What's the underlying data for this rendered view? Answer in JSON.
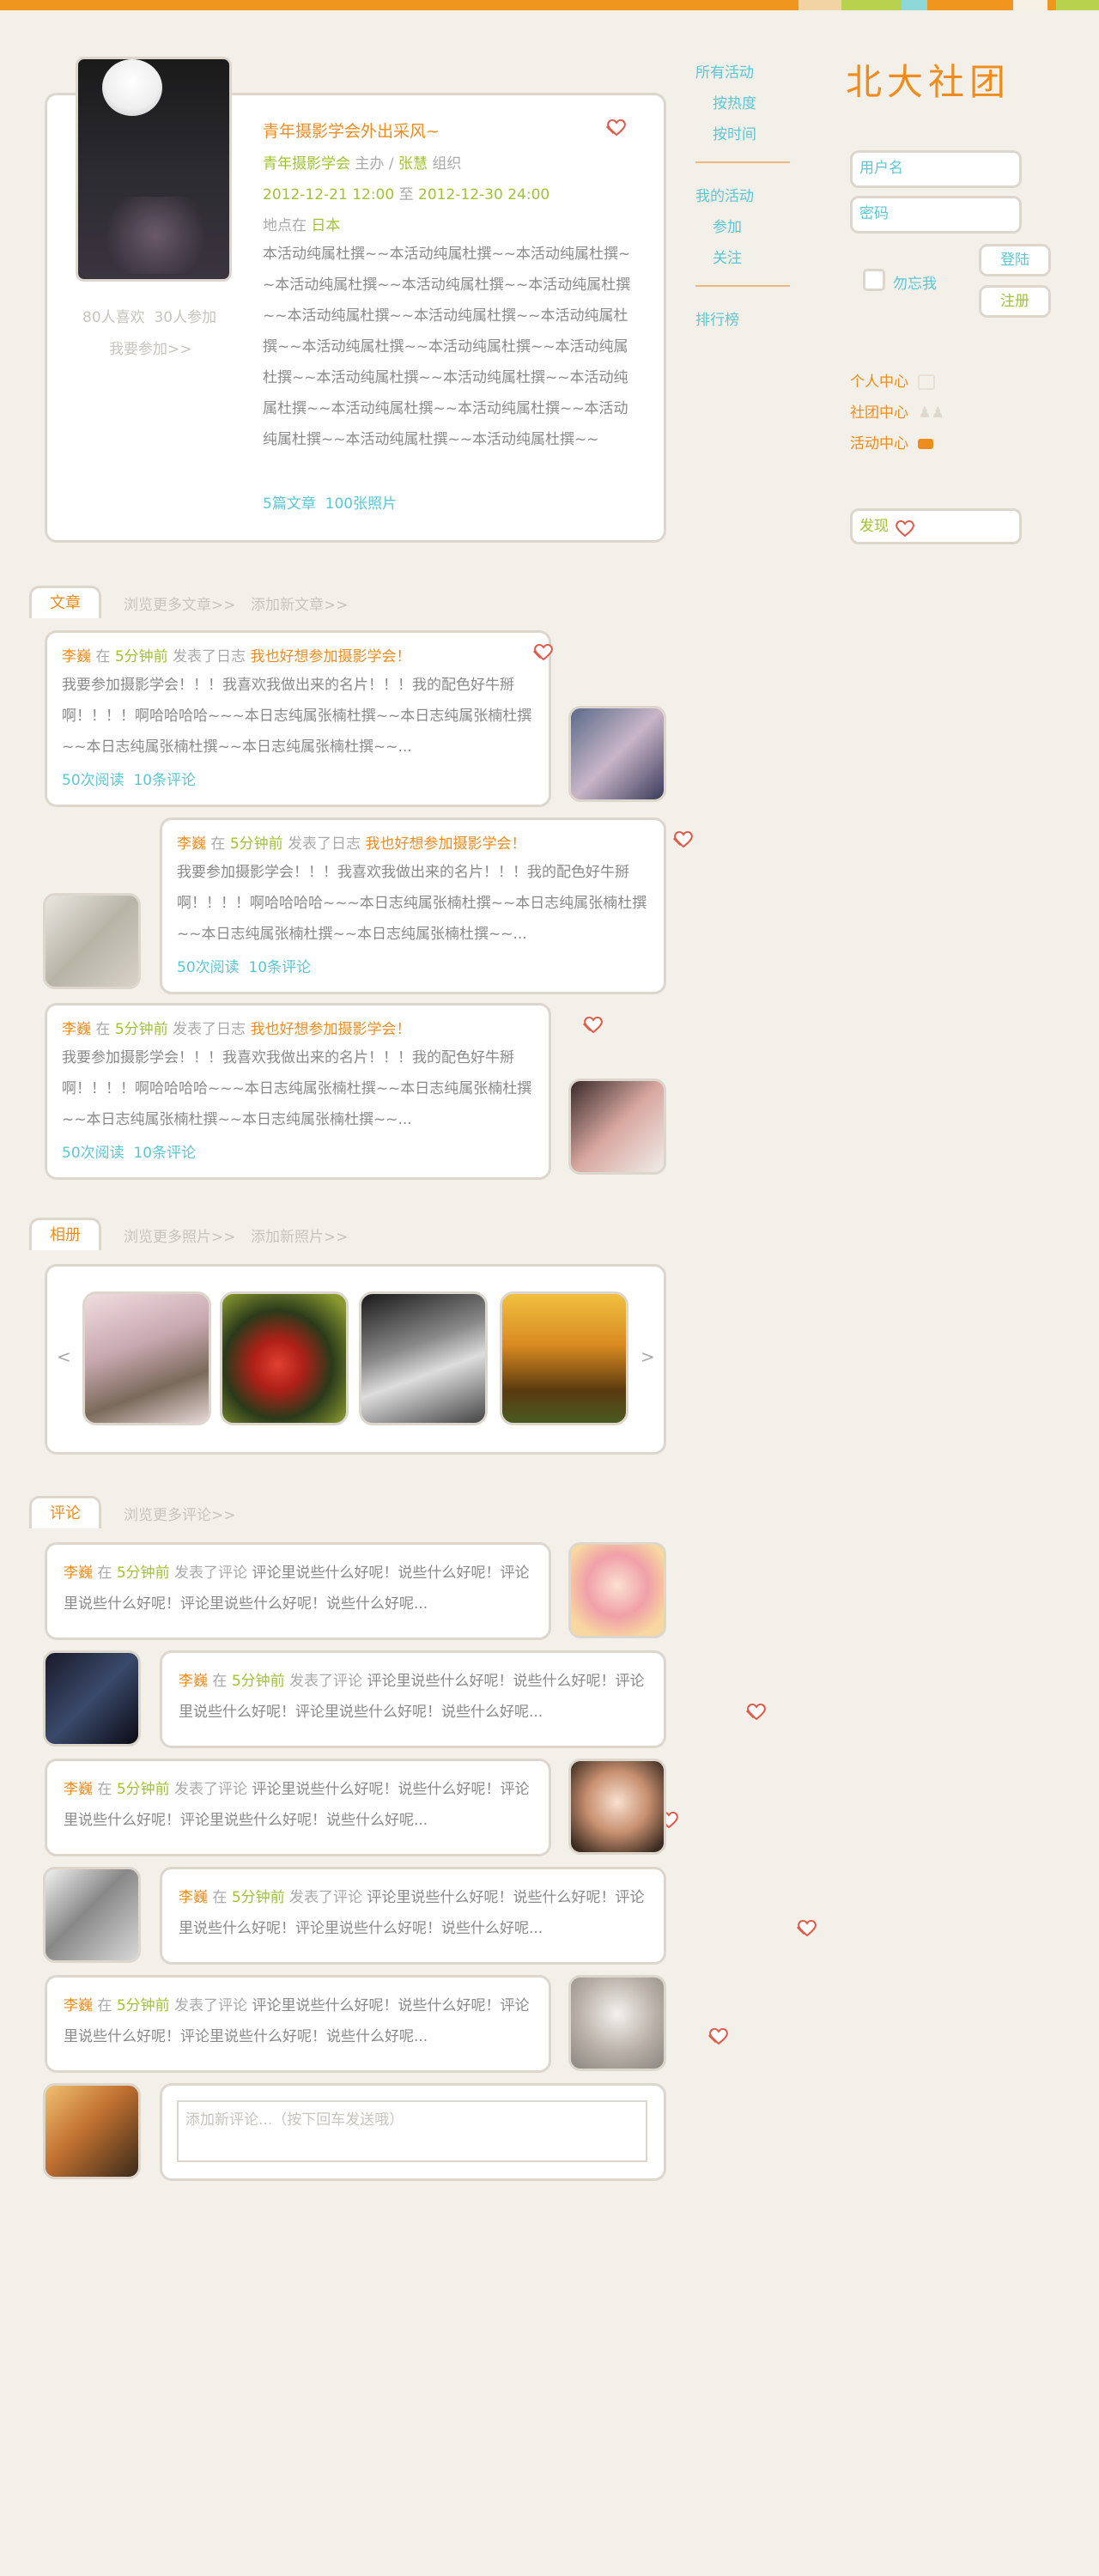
{
  "brand": {
    "logo_text": "北大社团"
  },
  "nav": {
    "all_events": "所有活动",
    "by_hot": "按热度",
    "by_time": "按时间",
    "my_events": "我的活动",
    "joined": "参加",
    "followed": "关注",
    "ranking": "排行榜"
  },
  "login": {
    "username_placeholder": "用户名",
    "password_placeholder": "密码",
    "remember": "勿忘我",
    "login": "登陆",
    "register": "注册"
  },
  "user_links": {
    "personal": "个人中心",
    "club": "社团中心",
    "activity": "活动中心"
  },
  "discover": {
    "label": "发现"
  },
  "event": {
    "title": "青年摄影学会外出采风~",
    "org": "青年摄影学会",
    "host_label": "主办",
    "sep": "/",
    "person": "张慧",
    "org_label": "组织",
    "start": "2012-12-21 12:00",
    "to": "至",
    "end": "2012-12-30 24:00",
    "place_label": "地点在",
    "place": "日本",
    "desc": "本活动纯属杜撰~~本活动纯属杜撰~~本活动纯属杜撰~~本活动纯属杜撰~~本活动纯属杜撰~~本活动纯属杜撰~~本活动纯属杜撰~~本活动纯属杜撰~~本活动纯属杜撰~~本活动纯属杜撰~~本活动纯属杜撰~~本活动纯属杜撰~~本活动纯属杜撰~~本活动纯属杜撰~~本活动纯属杜撰~~本活动纯属杜撰~~本活动纯属杜撰~~本活动纯属杜撰~~本活动纯属杜撰~~本活动纯属杜撰~~",
    "articles": "5篇文章",
    "photos": "100张照片",
    "likes": "80人喜欢",
    "participants": "30人参加",
    "join": "我要参加>>"
  },
  "articles_section": {
    "tab": "文章",
    "more": "浏览更多文章>>",
    "add": "添加新文章>>",
    "items": [
      {
        "author": "李巍",
        "in": "在",
        "time": "5分钟前",
        "action": "发表了日志",
        "title": "我也好想参加摄影学会！",
        "body": "我要参加摄影学会！！！我喜欢我做出来的名片！！！我的配色好牛掰啊！！！！啊哈哈哈哈~~~本日志纯属张楠杜撰~~本日志纯属张楠杜撰~~本日志纯属张楠杜撰~~本日志纯属张楠杜撰~~...",
        "reads": "50次阅读",
        "comments": "10条评论"
      },
      {
        "author": "李巍",
        "in": "在",
        "time": "5分钟前",
        "action": "发表了日志",
        "title": "我也好想参加摄影学会！",
        "body": "我要参加摄影学会！！！我喜欢我做出来的名片！！！我的配色好牛掰啊！！！！啊哈哈哈哈~~~本日志纯属张楠杜撰~~本日志纯属张楠杜撰~~本日志纯属张楠杜撰~~本日志纯属张楠杜撰~~...",
        "reads": "50次阅读",
        "comments": "10条评论"
      },
      {
        "author": "李巍",
        "in": "在",
        "time": "5分钟前",
        "action": "发表了日志",
        "title": "我也好想参加摄影学会！",
        "body": "我要参加摄影学会！！！我喜欢我做出来的名片！！！我的配色好牛掰啊！！！！啊哈哈哈哈~~~本日志纯属张楠杜撰~~本日志纯属张楠杜撰~~本日志纯属张楠杜撰~~本日志纯属张楠杜撰~~...",
        "reads": "50次阅读",
        "comments": "10条评论"
      }
    ]
  },
  "album_section": {
    "tab": "相册",
    "more": "浏览更多照片>>",
    "add": "添加新照片>>",
    "prev": "<",
    "next": ">"
  },
  "comments_section": {
    "tab": "评论",
    "more": "浏览更多评论>>",
    "items": [
      {
        "author": "李巍",
        "in": "在",
        "time": "5分钟前",
        "action": "发表了评论",
        "body": "评论里说些什么好呢！说些什么好呢！评论里说些什么好呢！评论里说些什么好呢！说些什么好呢..."
      },
      {
        "author": "李巍",
        "in": "在",
        "time": "5分钟前",
        "action": "发表了评论",
        "body": "评论里说些什么好呢！说些什么好呢！评论里说些什么好呢！评论里说些什么好呢！说些什么好呢..."
      },
      {
        "author": "李巍",
        "in": "在",
        "time": "5分钟前",
        "action": "发表了评论",
        "body": "评论里说些什么好呢！说些什么好呢！评论里说些什么好呢！评论里说些什么好呢！说些什么好呢..."
      },
      {
        "author": "李巍",
        "in": "在",
        "time": "5分钟前",
        "action": "发表了评论",
        "body": "评论里说些什么好呢！说些什么好呢！评论里说些什么好呢！评论里说些什么好呢！说些什么好呢..."
      },
      {
        "author": "李巍",
        "in": "在",
        "time": "5分钟前",
        "action": "发表了评论",
        "body": "评论里说些什么好呢！说些什么好呢！评论里说些什么好呢！评论里说些什么好呢！说些什么好呢..."
      }
    ],
    "new_placeholder": "添加新评论...（按下回车发送哦）"
  },
  "colors": {
    "orange": "#ee8d1e",
    "green": "#a0c332",
    "blue": "#5cc7d4",
    "background": "#f3efe9"
  }
}
